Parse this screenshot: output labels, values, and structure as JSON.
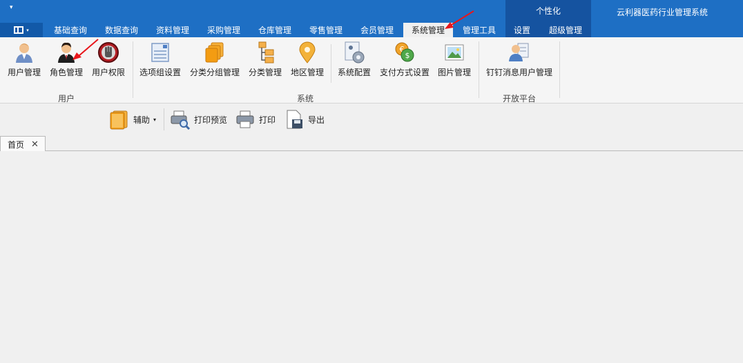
{
  "menubar": {
    "qat_dropdown": "▾",
    "tabs": [
      "基础查询",
      "数据查询",
      "资料管理",
      "采购管理",
      "仓库管理",
      "零售管理",
      "会员管理",
      "系统管理",
      "管理工具",
      "设置",
      "超级管理"
    ],
    "context_label": "个性化",
    "app_title": "云利器医药行业管理系统"
  },
  "ribbon": {
    "buttons": [
      "用户管理",
      "角色管理",
      "用户权限",
      "选项组设置",
      "分类分组管理",
      "分类管理",
      "地区管理",
      "系统配置",
      "支付方式设置",
      "图片管理",
      "钉钉消息用户管理"
    ],
    "groups": [
      "用户",
      "系统",
      "开放平台"
    ]
  },
  "toolbar": {
    "assist": "辅助",
    "print_preview": "打印预览",
    "print": "打印",
    "export": "导出"
  },
  "doc_tabs": {
    "home": "首页",
    "close": "✕"
  },
  "colors": {
    "titlebar": "#1e6fc4",
    "context": "#1553a0",
    "arrow": "#e8161b"
  },
  "icons": [
    "user-icon",
    "role-icon",
    "permission-icon",
    "option-group-icon",
    "category-group-icon",
    "category-tree-icon",
    "location-pin-icon",
    "config-gear-icon",
    "payment-coins-icon",
    "picture-icon",
    "dingtalk-user-icon",
    "assist-book-icon",
    "print-preview-icon",
    "printer-icon",
    "export-document-icon"
  ]
}
